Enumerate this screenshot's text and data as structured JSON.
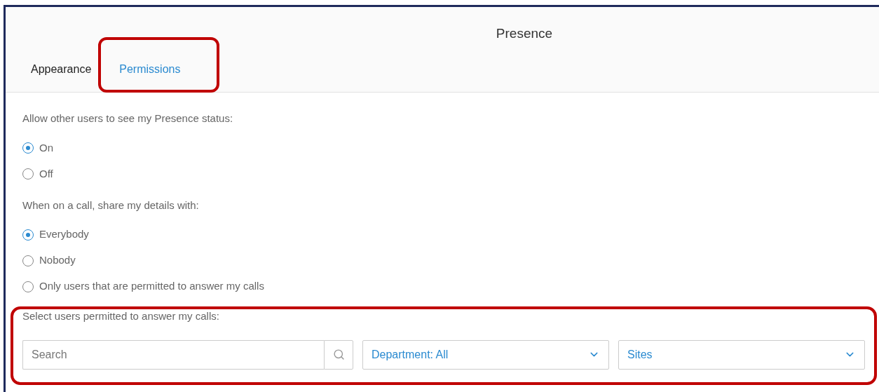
{
  "window": {
    "title": "Presence"
  },
  "tabs": [
    {
      "label": "Appearance",
      "selected": false
    },
    {
      "label": "Permissions",
      "selected": true
    }
  ],
  "radio_groups": [
    {
      "label": "Allow other users to see my Presence status:",
      "options": [
        {
          "label": "On",
          "selected": true
        },
        {
          "label": "Off",
          "selected": false
        }
      ]
    },
    {
      "label": "When on a call, share my details with:",
      "options": [
        {
          "label": "Everybody",
          "selected": true
        },
        {
          "label": "Nobody",
          "selected": false
        },
        {
          "label": "Only users that are permitted to answer my calls",
          "selected": false
        }
      ]
    }
  ],
  "answer_users": {
    "label": "Select users permitted to answer my calls:",
    "search": {
      "placeholder": "Search"
    },
    "dropdowns": [
      {
        "value": "Department: All"
      },
      {
        "value": "Sites"
      }
    ]
  }
}
